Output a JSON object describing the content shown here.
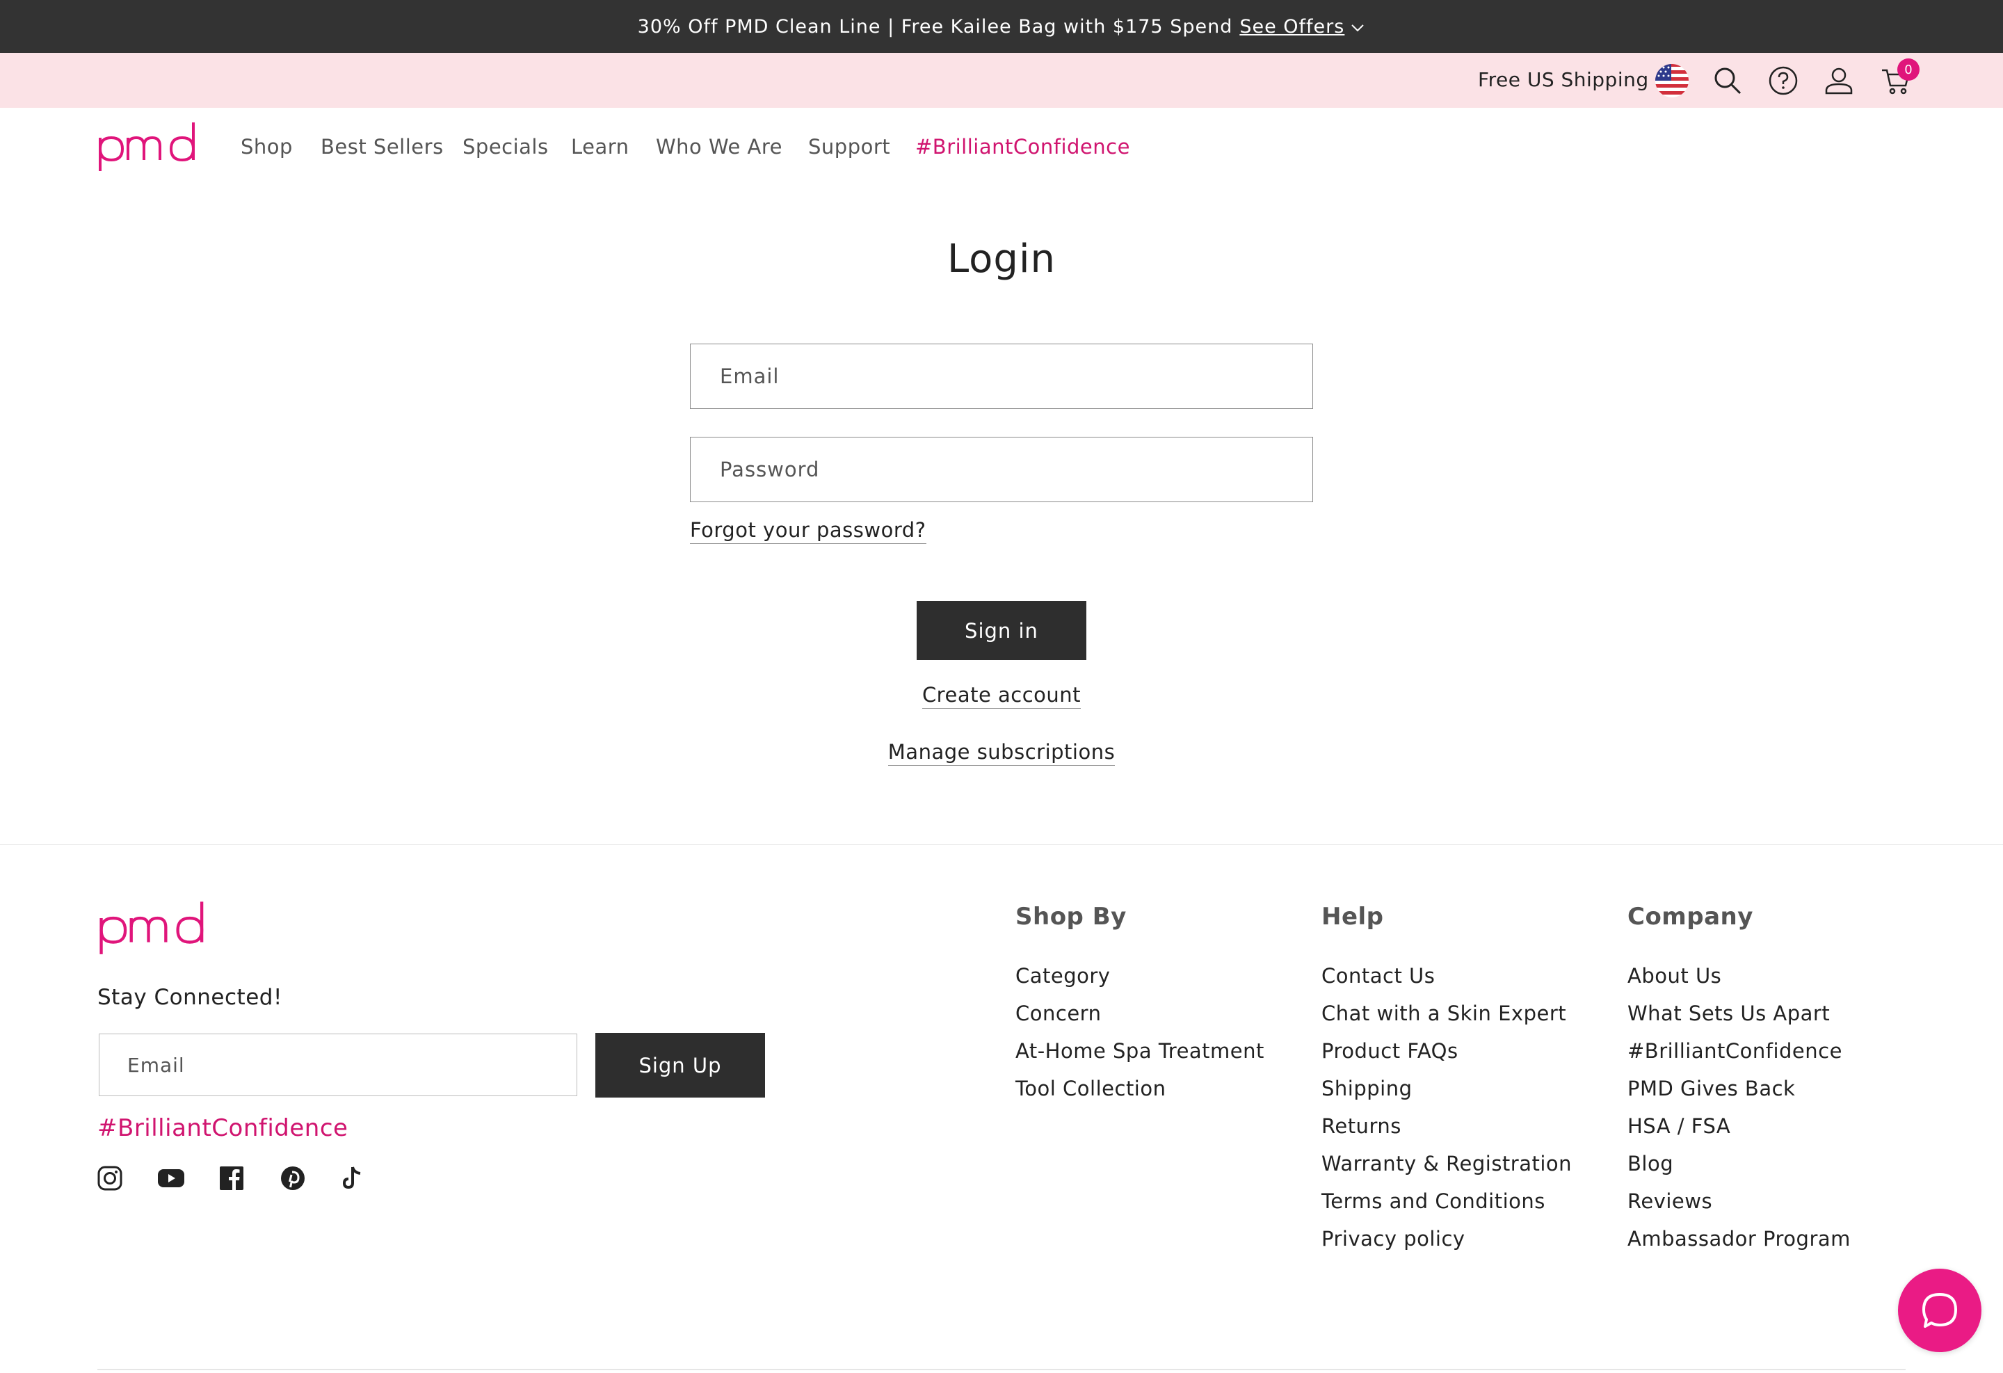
{
  "announcement": {
    "text": "30% Off PMD Clean Line | Free Kailee Bag with $175 Spend",
    "link": "See Offers"
  },
  "utility": {
    "shipping": "Free US Shipping",
    "cart_count": "0"
  },
  "nav": {
    "logo": "pmd",
    "items": [
      "Shop",
      "Best Sellers",
      "Specials",
      "Learn",
      "Who We Are",
      "Support",
      "#BrilliantConfidence"
    ]
  },
  "login": {
    "title": "Login",
    "email_placeholder": "Email",
    "password_placeholder": "Password",
    "forgot": "Forgot your password?",
    "sign_in": "Sign in",
    "create_account": "Create account",
    "manage_subscriptions": "Manage subscriptions"
  },
  "footer": {
    "logo": "pmd",
    "stay_connected": "Stay Connected!",
    "email_placeholder": "Email",
    "sign_up": "Sign Up",
    "hashtag": "#BrilliantConfidence",
    "social": [
      "instagram-icon",
      "youtube-icon",
      "facebook-icon",
      "pinterest-icon",
      "tiktok-icon"
    ],
    "columns": [
      {
        "heading": "Shop By",
        "links": [
          "Category",
          "Concern",
          "At-Home Spa Treatment",
          "Tool Collection"
        ]
      },
      {
        "heading": "Help",
        "links": [
          "Contact Us",
          "Chat with a Skin Expert",
          "Product FAQs",
          "Shipping",
          "Returns",
          "Warranty & Registration",
          "Terms and Conditions",
          "Privacy policy"
        ]
      },
      {
        "heading": "Company",
        "links": [
          "About Us",
          "What Sets Us Apart",
          "#BrilliantConfidence",
          "PMD Gives Back",
          "HSA / FSA",
          "Blog",
          "Reviews",
          "Ambassador Program"
        ]
      }
    ]
  },
  "colors": {
    "brand_pink": "#e0157b",
    "dark": "#2e2e2e",
    "utility_bg": "#fbe2e6"
  }
}
